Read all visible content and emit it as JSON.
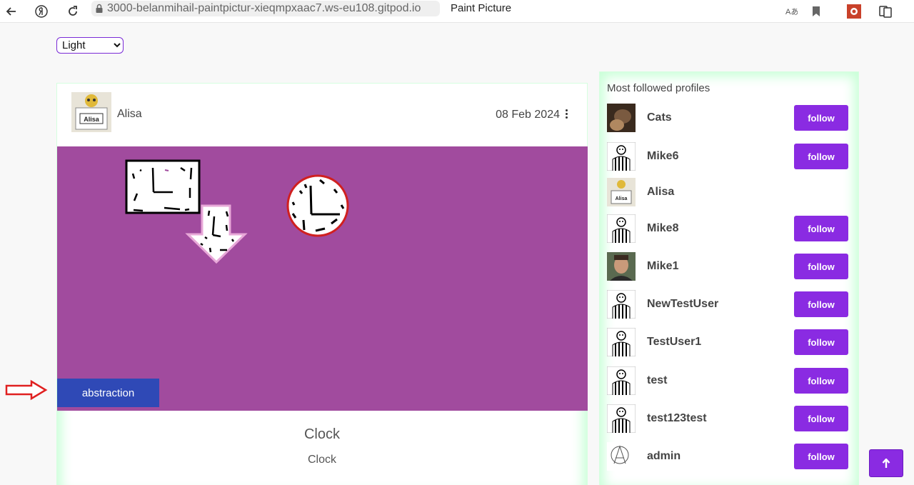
{
  "browser": {
    "url": "3000-belanmihail-paintpictur-xieqmpxaac7.ws-eu108.gitpod.io",
    "tab_title": "Paint Picture"
  },
  "theme": {
    "selected": "Light"
  },
  "post": {
    "author": "Alisa",
    "date": "08 Feb 2024",
    "tag": "abstraction",
    "title": "Clock",
    "description": "Clock",
    "canvas_color": "#a14b9e"
  },
  "sidebar": {
    "title": "Most followed profiles",
    "follow_label": "follow",
    "profiles": [
      {
        "name": "Cats",
        "avatar": "cat-photo",
        "follow": true
      },
      {
        "name": "Mike6",
        "avatar": "striped-figure",
        "follow": true
      },
      {
        "name": "Alisa",
        "avatar": "alisa-badge",
        "follow": false
      },
      {
        "name": "Mike8",
        "avatar": "striped-figure",
        "follow": true
      },
      {
        "name": "Mike1",
        "avatar": "man-photo",
        "follow": true
      },
      {
        "name": "NewTestUser",
        "avatar": "striped-figure",
        "follow": true
      },
      {
        "name": "TestUser1",
        "avatar": "striped-figure",
        "follow": true
      },
      {
        "name": "test",
        "avatar": "striped-figure",
        "follow": true
      },
      {
        "name": "test123test",
        "avatar": "striped-figure",
        "follow": true
      },
      {
        "name": "admin",
        "avatar": "anarchy-symbol",
        "follow": true
      }
    ]
  },
  "colors": {
    "accent": "#8a2be2",
    "tag": "#2f49b6",
    "glow": "#c8ffd7"
  }
}
